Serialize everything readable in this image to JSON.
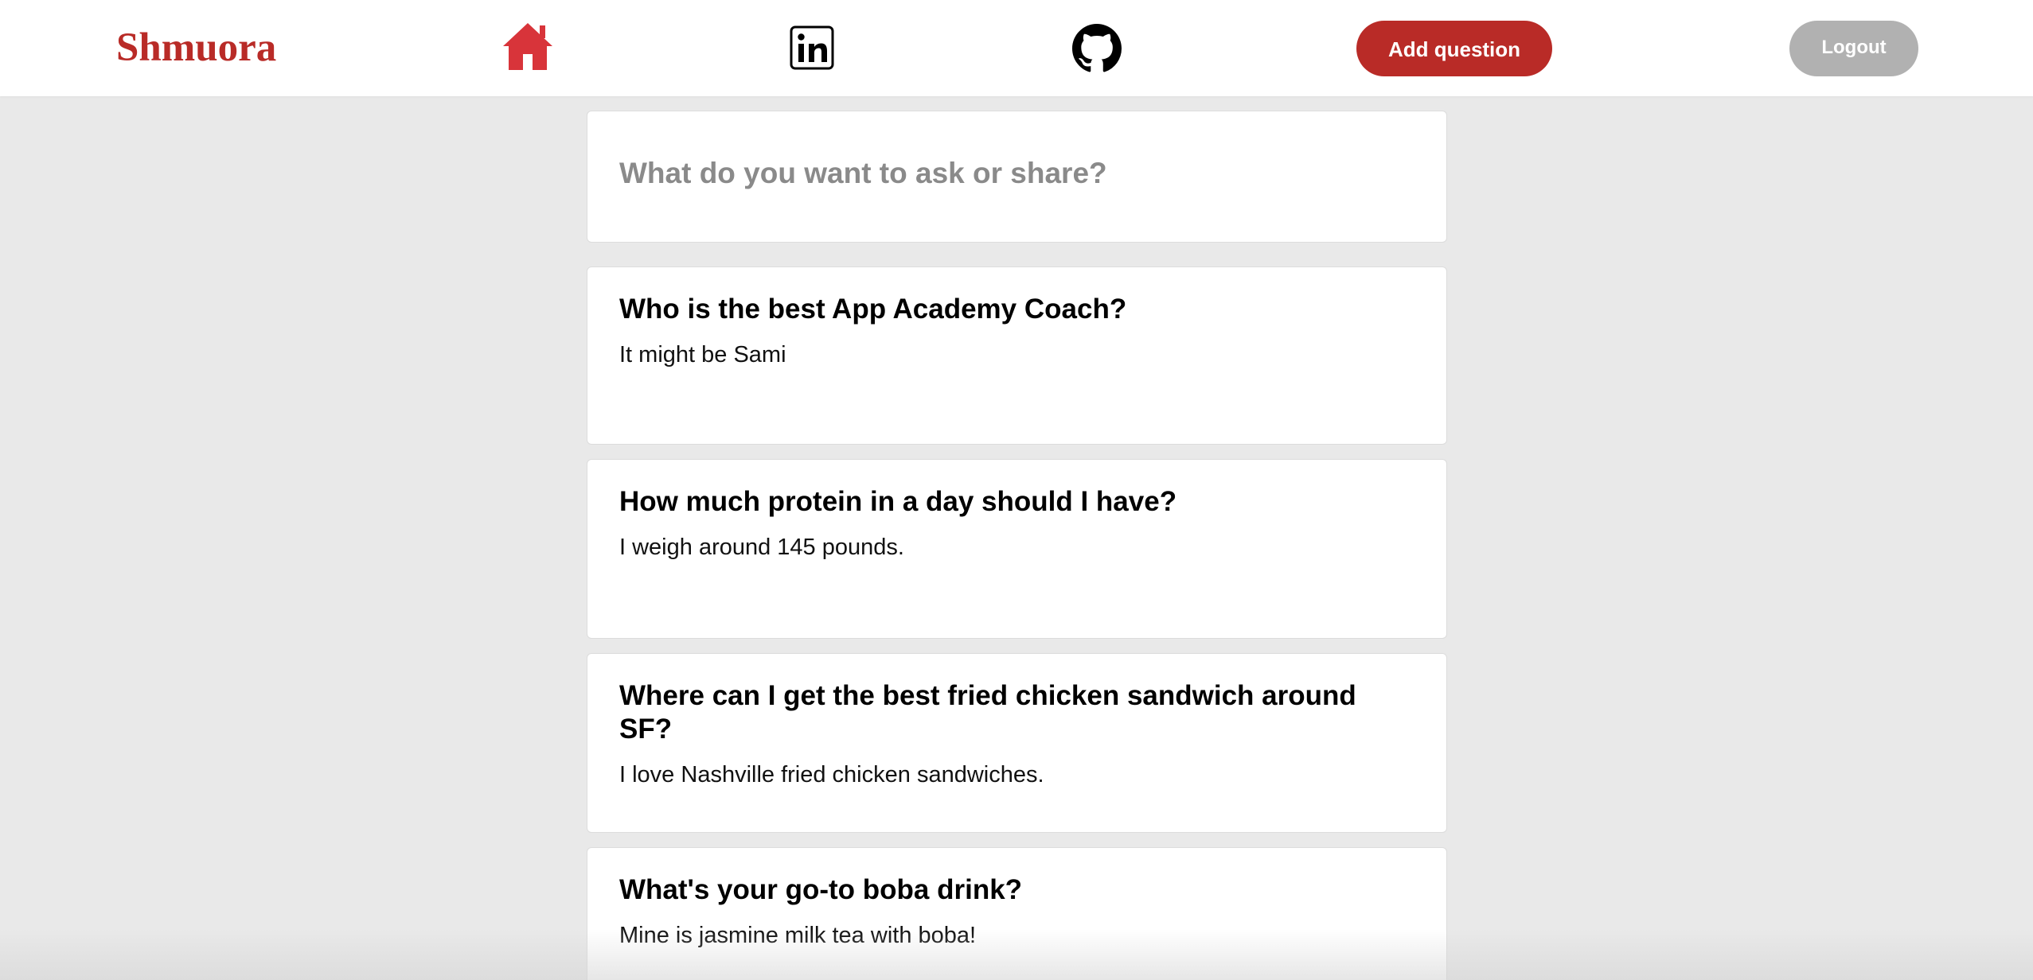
{
  "header": {
    "logo": "Shmuora",
    "icons": {
      "home": "home-icon",
      "linkedin": "linkedin-icon",
      "github": "github-icon"
    },
    "add_question_label": "Add question",
    "logout_label": "Logout"
  },
  "colors": {
    "brand": "#b92b27",
    "logout": "#b1b1b1",
    "background": "#e9e9e9"
  },
  "ask_box": {
    "placeholder": "What do you want to ask or share?"
  },
  "questions": [
    {
      "title": "Who is the best App Academy Coach?",
      "body": "It might be Sami"
    },
    {
      "title": "How much protein in a day should I have?",
      "body": "I weigh around 145 pounds."
    },
    {
      "title": "Where can I get the best fried chicken sandwich around SF?",
      "body": "I love Nashville fried chicken sandwiches."
    },
    {
      "title": "What's your go-to boba drink?",
      "body": "Mine is jasmine milk tea with boba!"
    }
  ]
}
